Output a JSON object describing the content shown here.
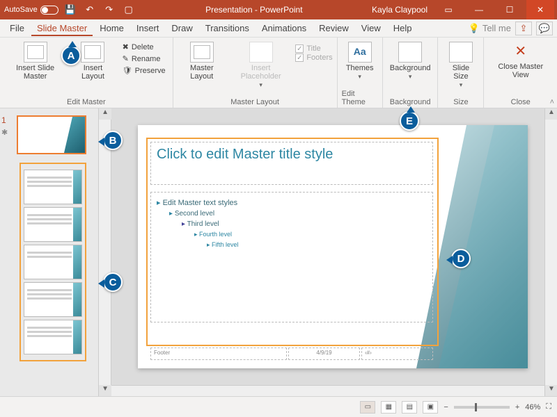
{
  "titlebar": {
    "autosave_label": "AutoSave",
    "autosave_state": "Off",
    "title": "Presentation - PowerPoint",
    "user": "Kayla Claypool"
  },
  "tabs": [
    "File",
    "Slide Master",
    "Home",
    "Insert",
    "Draw",
    "Transitions",
    "Animations",
    "Review",
    "View",
    "Help"
  ],
  "tabs_right": {
    "tellme": "Tell me"
  },
  "ribbon": {
    "edit_master": {
      "label": "Edit Master",
      "insert_slide_master": "Insert Slide\nMaster",
      "insert_layout": "Insert\nLayout",
      "delete": "Delete",
      "rename": "Rename",
      "preserve": "Preserve"
    },
    "master_layout": {
      "label": "Master Layout",
      "master_layout": "Master\nLayout",
      "insert_placeholder": "Insert\nPlaceholder",
      "title_chk": "Title",
      "footers_chk": "Footers"
    },
    "edit_theme": {
      "label": "Edit Theme",
      "themes": "Themes"
    },
    "background": {
      "label": "Background",
      "background": "Background"
    },
    "size": {
      "label": "Size",
      "slide_size": "Slide\nSize"
    },
    "close": {
      "label": "Close",
      "close_master": "Close\nMaster View"
    }
  },
  "thumbs": {
    "master_index": "1",
    "layout_count": 5
  },
  "slide": {
    "title_placeholder": "Click to edit Master title style",
    "body": [
      "Edit Master text styles",
      "Second level",
      "Third level",
      "Fourth level",
      "Fifth level"
    ],
    "footer": {
      "left": "Footer",
      "center": "4/9/19",
      "right": "‹#›"
    }
  },
  "status": {
    "zoom": "46%"
  },
  "callouts": {
    "A": "A",
    "B": "B",
    "C": "C",
    "D": "D",
    "E": "E"
  },
  "colors": {
    "accent": "#b7472a",
    "theme_teal": "#2e87a3",
    "callout_blue": "#0a5d9c",
    "highlight_orange": "#f2a23c"
  }
}
